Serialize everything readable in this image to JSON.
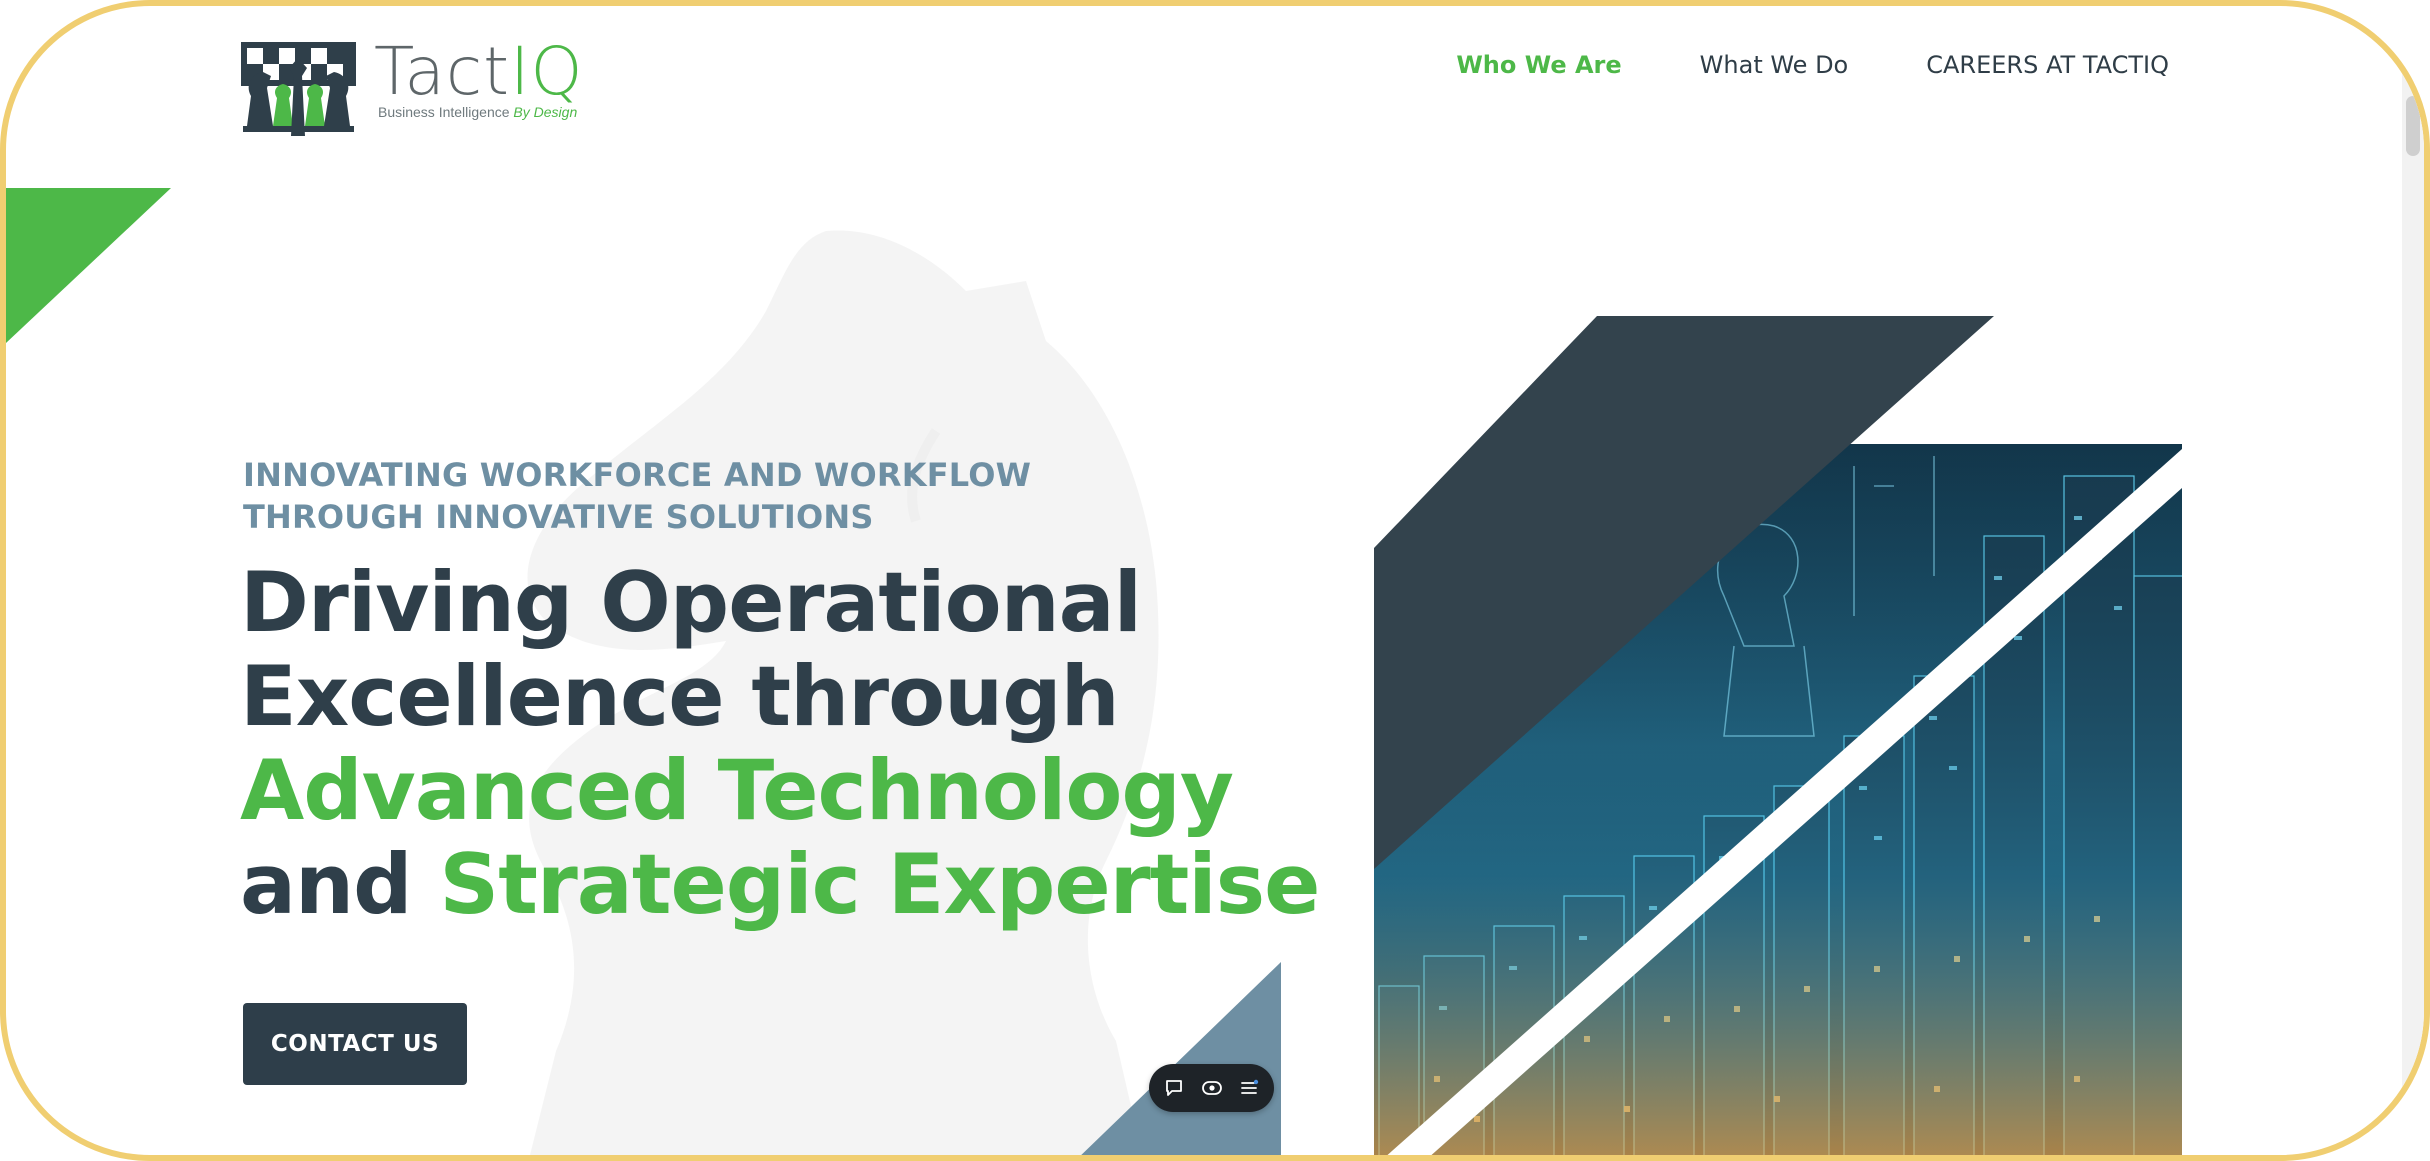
{
  "brand": {
    "name_main": "Tact",
    "name_accent": "IQ",
    "tagline_main": "Business Intelligence",
    "tagline_accent": "By Design"
  },
  "nav": {
    "items": [
      {
        "label": "Who We Are",
        "active": true
      },
      {
        "label": "What We Do",
        "active": false
      },
      {
        "label": "CAREERS AT TACTIQ",
        "active": false
      }
    ]
  },
  "hero": {
    "eyebrow_line1": "INNOVATING WORKFORCE AND WORKFLOW",
    "eyebrow_line2": "THROUGH INNOVATIVE SOLUTIONS",
    "headline": {
      "line1": "Driving Operational",
      "line2": "Excellence through",
      "line3_accent": "Advanced Technology",
      "line4_start": "and",
      "line4_accent": "Strategic Expertise"
    },
    "cta_label": "CONTACT US"
  },
  "widget": {
    "icons": [
      "chat-icon",
      "eye-icon",
      "menu-icon"
    ]
  },
  "colors": {
    "accent_green": "#4db848",
    "dark_slate": "#2f3f4a",
    "eyebrow_blue": "#6e8fa3",
    "frame_gold": "#f0ce71"
  }
}
